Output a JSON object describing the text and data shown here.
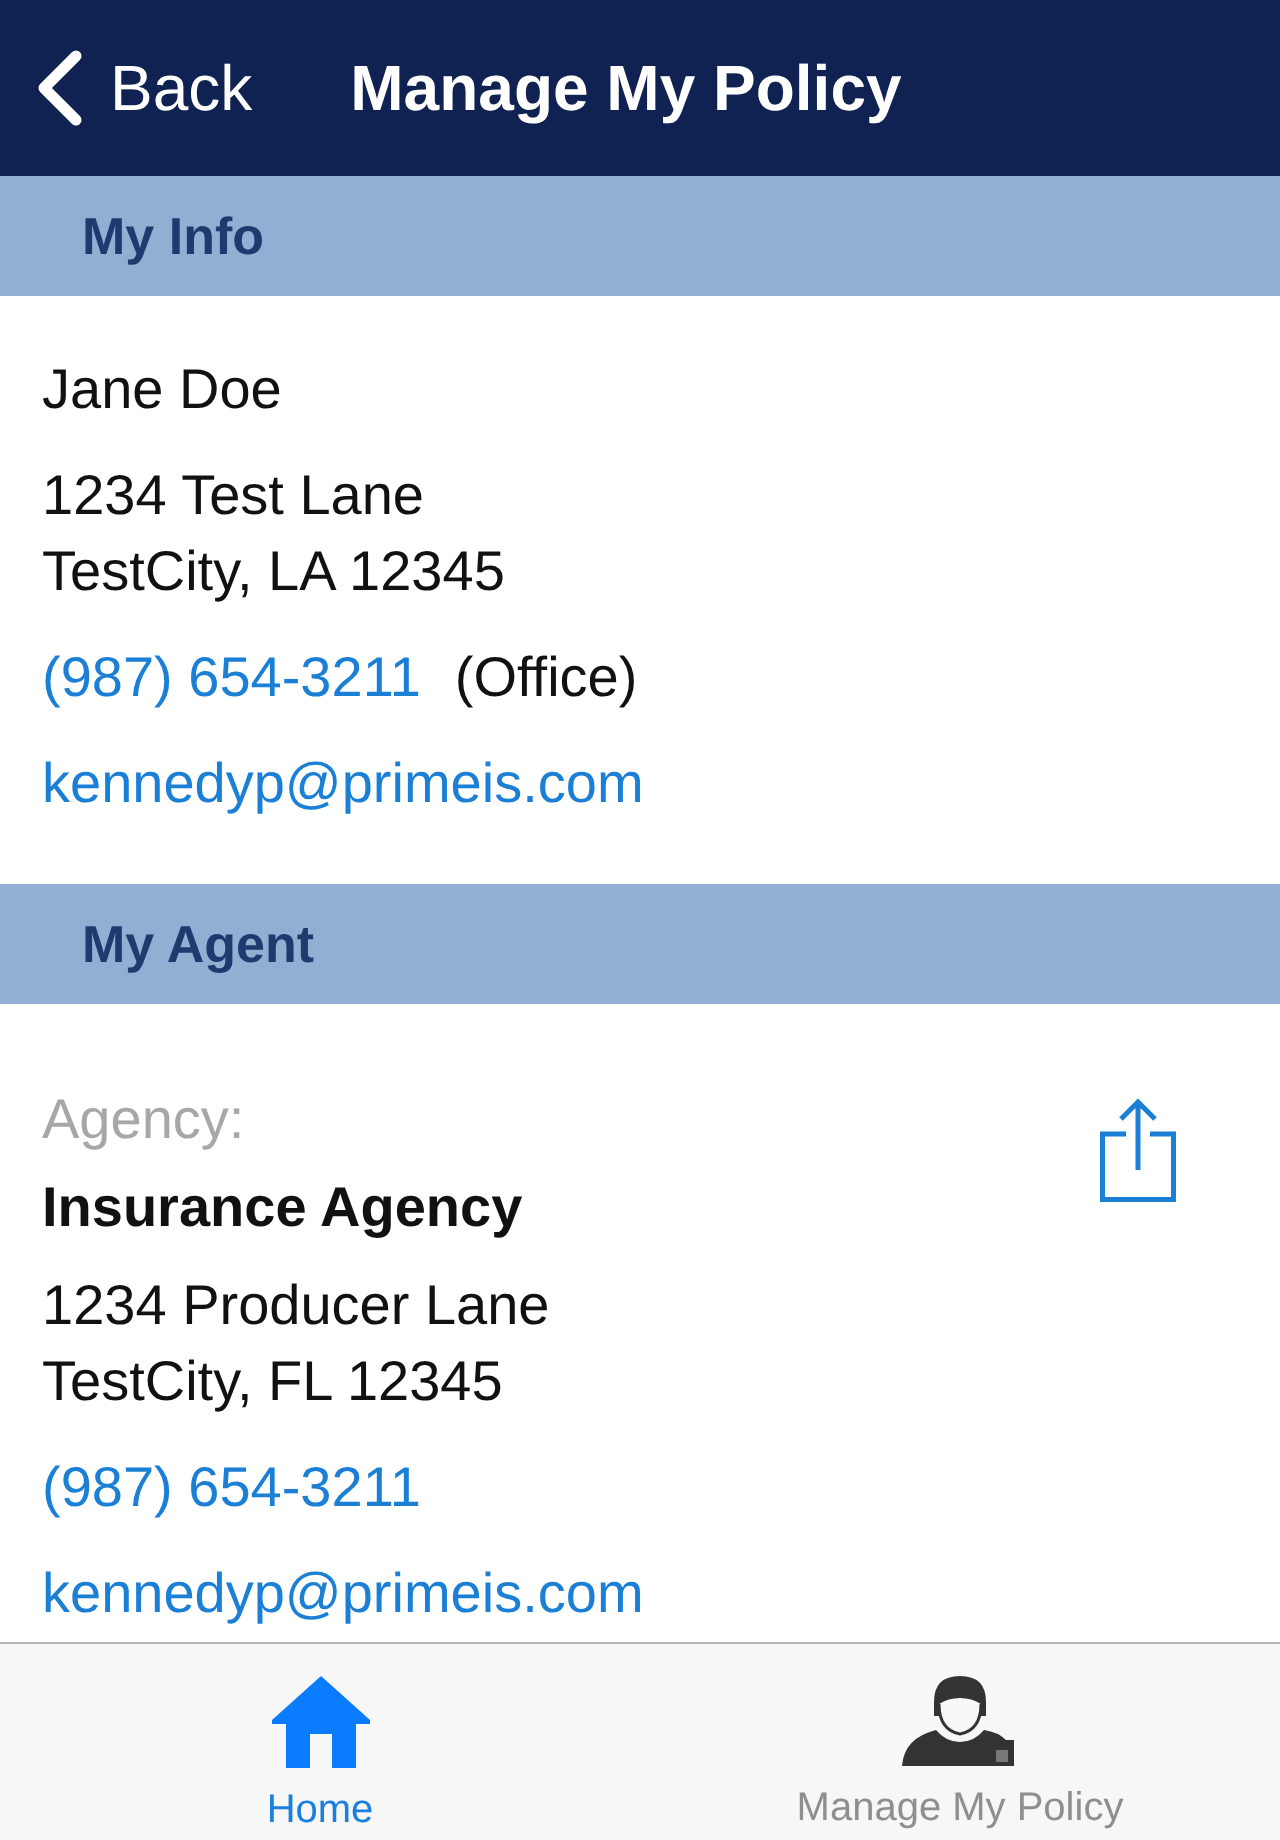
{
  "nav_bar": {
    "back_label": "Back",
    "title": "Manage My Policy"
  },
  "sections": [
    {
      "kind": "customer",
      "header": "My Info",
      "items": [
        {
          "kind": "name",
          "text": "Jane Doe"
        },
        {
          "kind": "address",
          "lines": [
            "1234 Test Lane",
            "TestCity, LA 12345"
          ]
        },
        {
          "kind": "phone",
          "text": "(987) 654-3211",
          "note": "(Office)"
        },
        {
          "kind": "email",
          "text": "kennedyp@primeis.com"
        }
      ]
    },
    {
      "kind": "agent",
      "header": "My Agent",
      "items": [
        {
          "kind": "label",
          "text": "Agency:"
        },
        {
          "kind": "org",
          "text": "Insurance Agency"
        },
        {
          "kind": "address",
          "lines": [
            "1234 Producer Lane",
            "TestCity, FL 12345"
          ]
        },
        {
          "kind": "phone",
          "text": "(987) 654-3211"
        },
        {
          "kind": "email",
          "text": "kennedyp@primeis.com"
        }
      ]
    }
  ],
  "tab_bar": {
    "tabs": [
      {
        "label": "Home",
        "selected": true
      },
      {
        "label": "Manage My Policy",
        "selected": false
      }
    ]
  }
}
